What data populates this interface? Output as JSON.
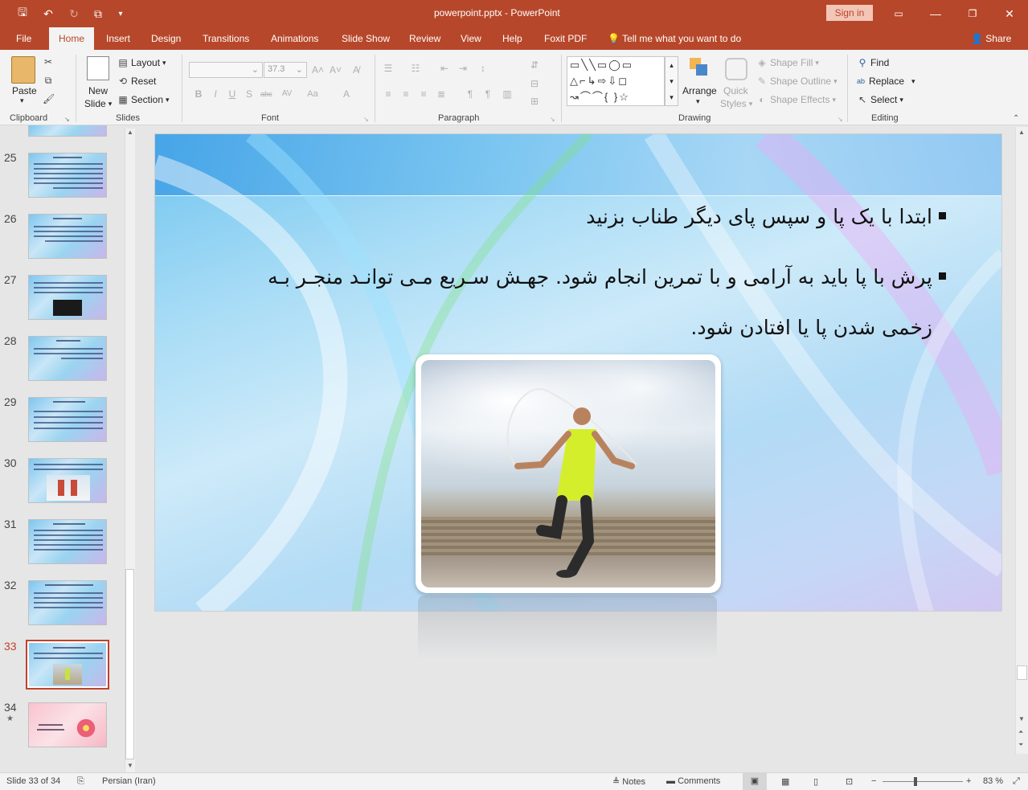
{
  "window": {
    "title": "powerpoint.pptx  -  PowerPoint",
    "sign_in": "Sign in"
  },
  "colors": {
    "accent": "#b7472a",
    "selected_thumb": "#c1432a"
  },
  "tabs": [
    "File",
    "Home",
    "Insert",
    "Design",
    "Transitions",
    "Animations",
    "Slide Show",
    "Review",
    "View",
    "Help",
    "Foxit PDF"
  ],
  "tell_me": "Tell me what you want to do",
  "share": "Share",
  "ribbon": {
    "clipboard": {
      "label": "Clipboard",
      "paste": "Paste"
    },
    "slides": {
      "label": "Slides",
      "new_slide_1": "New",
      "new_slide_2": "Slide",
      "layout": "Layout",
      "reset": "Reset",
      "section": "Section"
    },
    "font": {
      "label": "Font",
      "font_size": "37.3"
    },
    "paragraph": {
      "label": "Paragraph"
    },
    "drawing": {
      "label": "Drawing",
      "arrange": "Arrange",
      "quick_styles_1": "Quick",
      "quick_styles_2": "Styles",
      "shape_fill": "Shape Fill",
      "shape_outline": "Shape Outline",
      "shape_effects": "Shape Effects"
    },
    "editing": {
      "label": "Editing",
      "find": "Find",
      "replace": "Replace",
      "select": "Select"
    }
  },
  "thumbnails": [
    {
      "num": "25"
    },
    {
      "num": "26"
    },
    {
      "num": "27"
    },
    {
      "num": "28"
    },
    {
      "num": "29"
    },
    {
      "num": "30"
    },
    {
      "num": "31"
    },
    {
      "num": "32"
    },
    {
      "num": "33"
    },
    {
      "num": "34"
    }
  ],
  "slide": {
    "bullet1": "ابتدا با یک پا و سپس پای دیگر طناب بزنید",
    "bullet2_line1": "پرش با پا باید به آرامی و با تمرین انجام شود. جهـش سـریع مـی توانـد منجـر بـه",
    "bullet2_line2": "زخمی شدن پا یا افتادن شود."
  },
  "status": {
    "slide": "Slide 33 of 34",
    "language": "Persian (Iran)",
    "notes": "Notes",
    "comments": "Comments",
    "zoom": "83 %"
  }
}
